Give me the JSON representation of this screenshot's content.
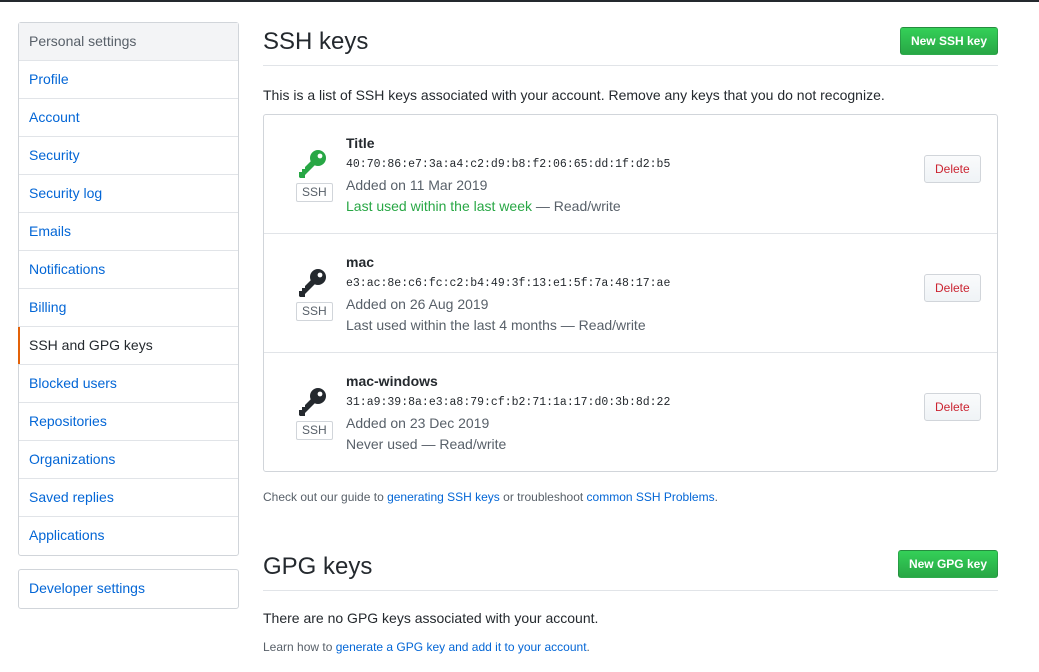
{
  "sidebar": {
    "heading": "Personal settings",
    "items": [
      {
        "label": "Profile"
      },
      {
        "label": "Account"
      },
      {
        "label": "Security"
      },
      {
        "label": "Security log"
      },
      {
        "label": "Emails"
      },
      {
        "label": "Notifications"
      },
      {
        "label": "Billing"
      },
      {
        "label": "SSH and GPG keys",
        "selected": true
      },
      {
        "label": "Blocked users"
      },
      {
        "label": "Repositories"
      },
      {
        "label": "Organizations"
      },
      {
        "label": "Saved replies"
      },
      {
        "label": "Applications"
      }
    ],
    "developer_settings": "Developer settings"
  },
  "ssh": {
    "title": "SSH keys",
    "new_button": "New SSH key",
    "description": "This is a list of SSH keys associated with your account. Remove any keys that you do not recognize.",
    "keys": [
      {
        "title": "Title",
        "fingerprint": "40:70:86:e7:3a:a4:c2:d9:b8:f2:06:65:dd:1f:d2:b5",
        "added": "Added on 11 Mar 2019",
        "last_used": "Last used within the last week",
        "access": " — Read/write",
        "badge": "SSH",
        "delete_label": "Delete",
        "icon": "key-icon",
        "icon_color": "#28a745"
      },
      {
        "title": "mac",
        "fingerprint": "e3:ac:8e:c6:fc:c2:b4:49:3f:13:e1:5f:7a:48:17:ae",
        "added": "Added on 26 Aug 2019",
        "last_used": "Last used within the last 4 months",
        "access": " — Read/write",
        "badge": "SSH",
        "delete_label": "Delete",
        "icon": "key-icon",
        "icon_color": "#24292e"
      },
      {
        "title": "mac-windows",
        "fingerprint": "31:a9:39:8a:e3:a8:79:cf:b2:71:1a:17:d0:3b:8d:22",
        "added": "Added on 23 Dec 2019",
        "last_used": "Never used",
        "access": " — Read/write",
        "badge": "SSH",
        "delete_label": "Delete",
        "icon": "key-icon",
        "icon_color": "#24292e"
      }
    ],
    "guide": {
      "prefix": "Check out our guide to ",
      "link1": "generating SSH keys",
      "middle": " or troubleshoot ",
      "link2": "common SSH Problems",
      "suffix": "."
    }
  },
  "gpg": {
    "title": "GPG keys",
    "new_button": "New GPG key",
    "empty_text": "There are no GPG keys associated with your account.",
    "learn": {
      "prefix": "Learn how to ",
      "link": "generate a GPG key and add it to your account",
      "suffix": "."
    }
  },
  "colors": {
    "link": "#0366d6",
    "green": "#28a745",
    "danger": "#cb2431",
    "selected_accent": "#e36209"
  }
}
